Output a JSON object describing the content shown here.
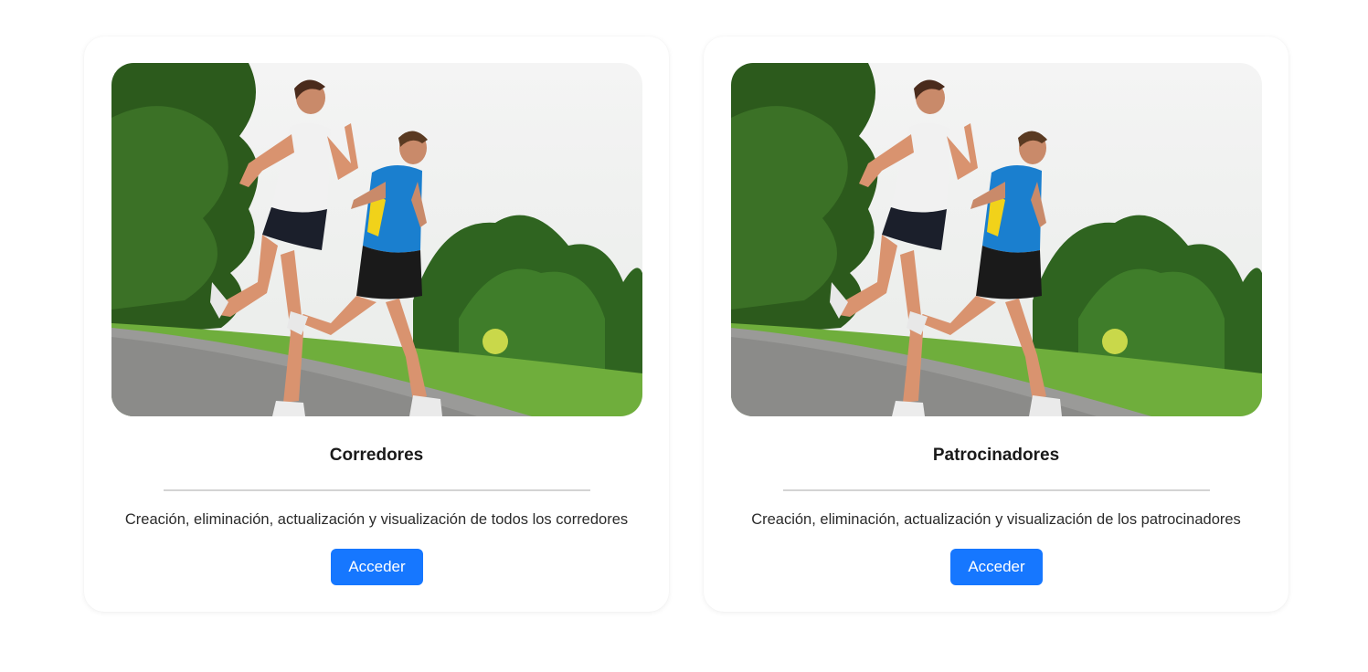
{
  "cards": [
    {
      "title": "Corredores",
      "description": "Creación, eliminación, actualización y visualización de todos los corredores",
      "button_label": "Acceder",
      "image_alt": "two-people-jogging-in-park-photo"
    },
    {
      "title": "Patrocinadores",
      "description": "Creación, eliminación, actualización y visualización de los patrocinadores",
      "button_label": "Acceder",
      "image_alt": "two-people-jogging-in-park-photo"
    }
  ],
  "colors": {
    "button": "#1677ff",
    "divider": "#d3d3d3",
    "sky": "#f2f2f2",
    "grass": "#6fae3c",
    "trees": "#2f5e1f"
  }
}
